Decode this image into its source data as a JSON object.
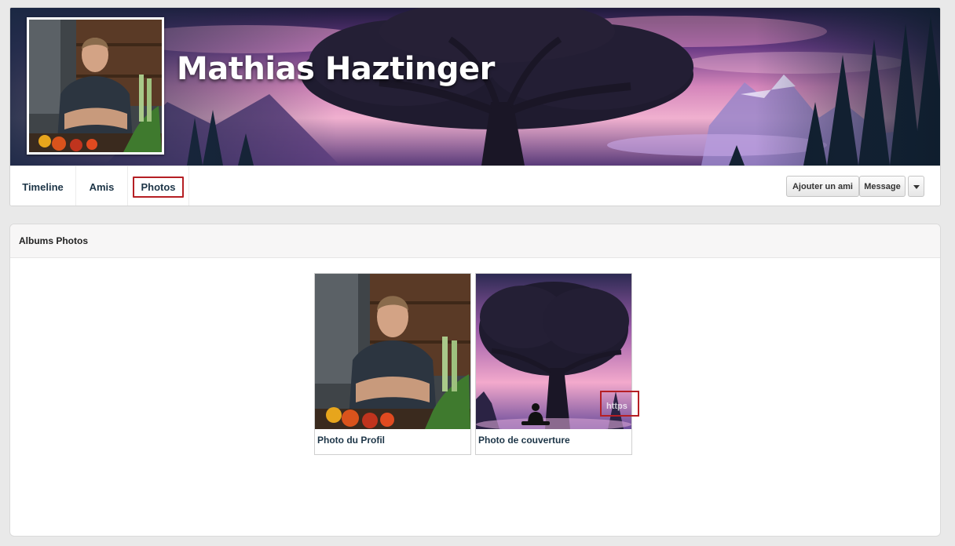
{
  "profile": {
    "name": "Mathias Haztinger"
  },
  "nav": {
    "tabs": [
      "Timeline",
      "Amis",
      "Photos"
    ],
    "active_tab": "Photos",
    "actions": {
      "add_friend": "Ajouter un ami",
      "message": "Message"
    }
  },
  "albums": {
    "heading": "Albums Photos",
    "items": [
      {
        "label": "Photo du Profil"
      },
      {
        "label": "Photo de couverture",
        "watermark": "https"
      }
    ]
  },
  "colors": {
    "highlight": "#b51f24",
    "tab_text": "#1d3547",
    "page_bg": "#e9e9e9"
  }
}
